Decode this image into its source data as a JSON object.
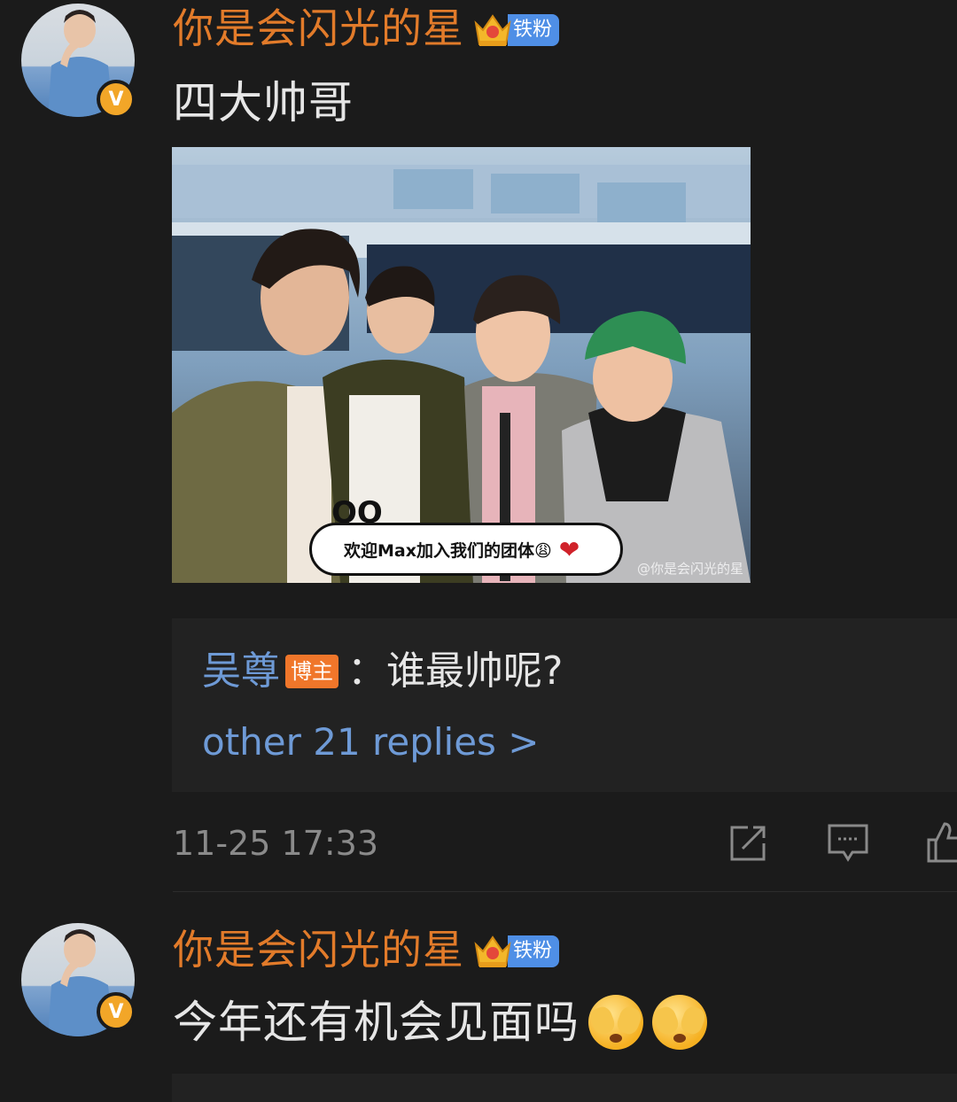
{
  "comments": [
    {
      "username": "你是会闪光的星",
      "fan_badge": "铁粉",
      "text": "四大帅哥",
      "photo": {
        "sticker_eyes": "OO",
        "sticker_text": "欢迎Max加入我们的团体😩",
        "sticker_heart": "❤",
        "watermark": "@你是会闪光的星"
      },
      "reply": {
        "author": "吴尊",
        "author_badge": "博主",
        "text": "：谁最帅呢?",
        "more": "other 21 replies >"
      },
      "timestamp": "11-25 17:33"
    },
    {
      "username": "你是会闪光的星",
      "fan_badge": "铁粉",
      "text": "今年还有机会见面吗"
    }
  ],
  "icons": {
    "verified": "V",
    "share": "share-icon",
    "reply": "comment-icon",
    "like": "thumbs-up-icon",
    "crown": "crown-icon"
  },
  "colors": {
    "background": "#1b1b1b",
    "username": "#e27b2a",
    "link_blue": "#6e9ad6",
    "host_badge": "#f0762a",
    "fan_badge": "#4f8fe6",
    "verified_badge": "#f2a628"
  }
}
